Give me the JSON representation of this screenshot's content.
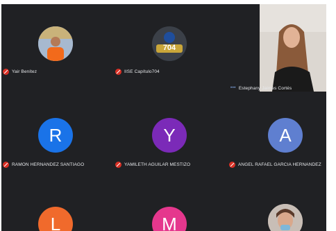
{
  "participants": [
    {
      "name": "Yair Benítez"
    },
    {
      "name": "IISE Capítulo704",
      "logo_text": "704"
    },
    {
      "name": "Estephany Jaimes Cortés"
    },
    {
      "name": "RAMON HERNANDEZ SANTIAGO",
      "initial": "R",
      "color": "#1a73e8"
    },
    {
      "name": "YAMILETH AGUILAR MESTIZO",
      "initial": "Y",
      "color": "#7b2ab8"
    },
    {
      "name": "ANGEL RAFAEL GARCIA HERNANDEZ",
      "initial": "A",
      "color": "#5f7fd0"
    },
    {
      "initial": "L",
      "color": "#f06a2c"
    },
    {
      "initial": "M",
      "color": "#e5378d"
    }
  ],
  "icons": {
    "mic_off": "mic-off-icon",
    "more": "more-options-icon"
  }
}
